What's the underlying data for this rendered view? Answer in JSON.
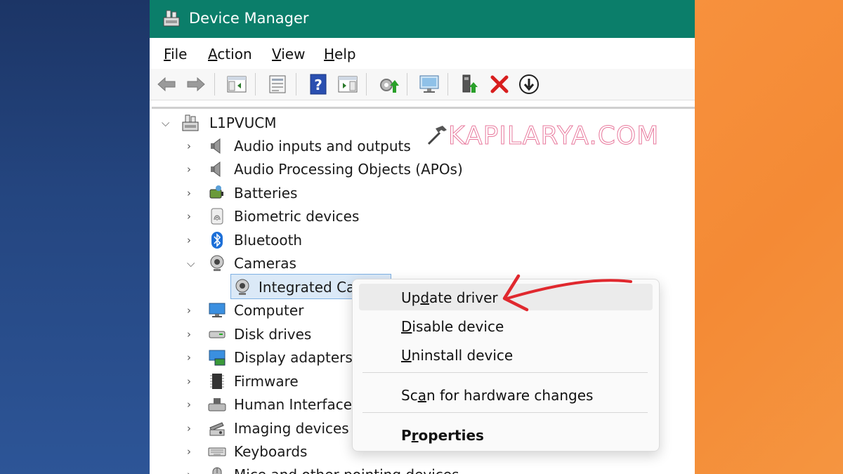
{
  "window": {
    "title": "Device Manager",
    "accent": "#0b7e6a"
  },
  "menu": [
    {
      "pre": "",
      "acc": "F",
      "post": "ile"
    },
    {
      "pre": "",
      "acc": "A",
      "post": "ction"
    },
    {
      "pre": "",
      "acc": "V",
      "post": "iew"
    },
    {
      "pre": "",
      "acc": "H",
      "post": "elp"
    }
  ],
  "toolbar": {
    "icons": [
      "back-arrow-icon",
      "forward-arrow-icon",
      "show-hide-console-tree-icon",
      "properties-icon",
      "help-icon",
      "action-pane-icon",
      "update-driver-icon",
      "scan-hardware-icon",
      "enable-device-icon",
      "uninstall-icon",
      "disable-device-icon"
    ]
  },
  "tree": {
    "root": "L1PVUCM",
    "items": [
      {
        "label": "Audio inputs and outputs",
        "icon": "speaker-icon",
        "expanded": false
      },
      {
        "label": "Audio Processing Objects (APOs)",
        "icon": "speaker-icon",
        "expanded": false
      },
      {
        "label": "Batteries",
        "icon": "battery-icon",
        "expanded": false
      },
      {
        "label": "Biometric devices",
        "icon": "fingerprint-icon",
        "expanded": false
      },
      {
        "label": "Bluetooth",
        "icon": "bluetooth-icon",
        "expanded": false
      },
      {
        "label": "Cameras",
        "icon": "webcam-icon",
        "expanded": true
      },
      {
        "label": "Integrated Ca",
        "icon": "webcam-icon",
        "child": true
      },
      {
        "label": "Computer",
        "icon": "monitor-icon",
        "expanded": false
      },
      {
        "label": "Disk drives",
        "icon": "disk-drive-icon",
        "expanded": false
      },
      {
        "label": "Display adapters",
        "icon": "display-adapter-icon",
        "expanded": false
      },
      {
        "label": "Firmware",
        "icon": "chip-icon",
        "expanded": false
      },
      {
        "label": "Human Interface",
        "icon": "hid-icon",
        "expanded": false
      },
      {
        "label": "Imaging devices",
        "icon": "scanner-icon",
        "expanded": false
      },
      {
        "label": "Keyboards",
        "icon": "keyboard-icon",
        "expanded": false
      },
      {
        "label": "Mice and other pointing devices",
        "icon": "mouse-icon",
        "expanded": false
      }
    ]
  },
  "watermark": "KAPILARYA.COM",
  "context_menu": {
    "update": {
      "pre": "Up",
      "acc": "d",
      "post": "ate driver"
    },
    "disable": {
      "pre": "",
      "acc": "D",
      "post": "isable device"
    },
    "uninstall": {
      "pre": "",
      "acc": "U",
      "post": "ninstall device"
    },
    "scan": {
      "pre": "Sc",
      "acc": "a",
      "post": "n for hardware changes"
    },
    "properties": {
      "pre": "P",
      "acc": "r",
      "post": "operties"
    }
  },
  "annotation_color": "#e0282e"
}
